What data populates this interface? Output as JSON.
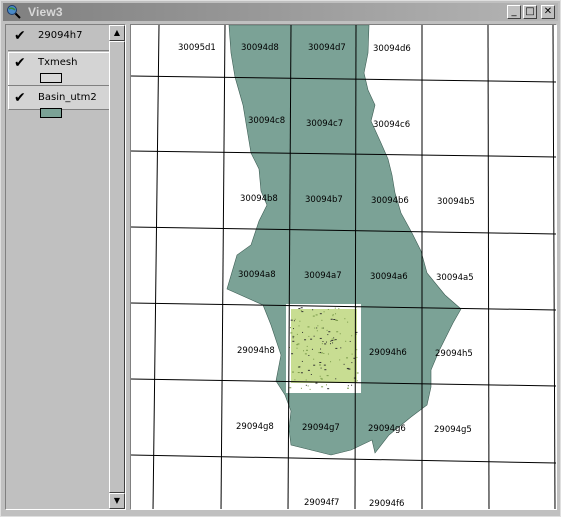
{
  "window": {
    "title": "View3"
  },
  "title_buttons": {
    "minimize": "_",
    "maximize": "□",
    "close": "✕"
  },
  "toc": {
    "layers": [
      {
        "name": "29094h7",
        "checked": true,
        "check_glyph": "✔"
      },
      {
        "name": "Txmesh",
        "checked": true,
        "check_glyph": "✔",
        "swatch_color": "#d8d8d8"
      },
      {
        "name": "Basin_utm2",
        "checked": true,
        "check_glyph": "✔",
        "swatch_color": "#7ba296"
      }
    ]
  },
  "scroll": {
    "up": "▲",
    "down": "▼"
  },
  "map": {
    "basin_color": "#7ba296",
    "grid_color": "#000000",
    "raster_color": "#c8dd92",
    "quad_labels": [
      "30095d1",
      "30094d8",
      "30094d7",
      "30094d6",
      "30094c8",
      "30094c7",
      "30094c6",
      "30094b8",
      "30094b7",
      "30094b6",
      "30094b5",
      "30094a8",
      "30094a7",
      "30094a6",
      "30094a5",
      "29094h8",
      "29094h6",
      "29094h5",
      "29094g8",
      "29094g7",
      "29094g6",
      "29094g5",
      "29094f7",
      "29094f6"
    ]
  }
}
